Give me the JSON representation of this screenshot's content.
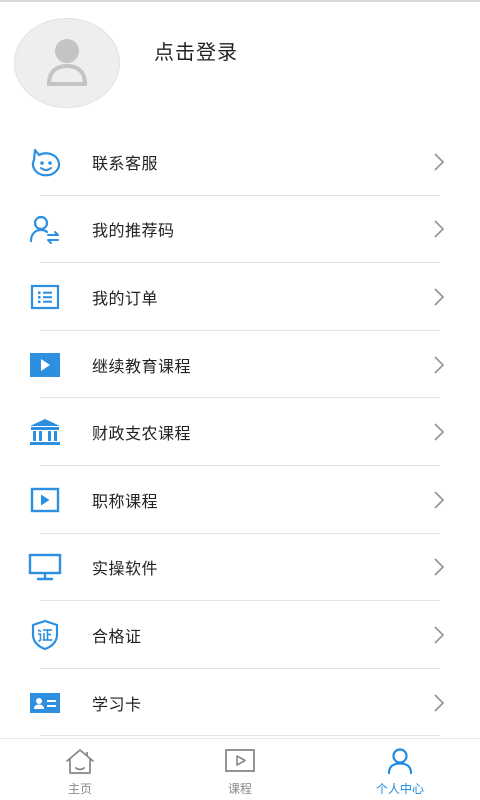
{
  "header": {
    "login_text": "点击登录"
  },
  "menu": {
    "items": [
      {
        "label": "联系客服",
        "icon": "service-face-icon"
      },
      {
        "label": "我的推荐码",
        "icon": "user-share-icon"
      },
      {
        "label": "我的订单",
        "icon": "order-list-icon"
      },
      {
        "label": "继续教育课程",
        "icon": "play-video-filled-icon"
      },
      {
        "label": "财政支农课程",
        "icon": "bank-building-icon"
      },
      {
        "label": "职称课程",
        "icon": "play-video-outline-icon"
      },
      {
        "label": "实操软件",
        "icon": "monitor-icon"
      },
      {
        "label": "合格证",
        "icon": "certificate-shield-icon"
      },
      {
        "label": "学习卡",
        "icon": "id-card-icon"
      }
    ]
  },
  "tabbar": {
    "tabs": [
      {
        "label": "主页",
        "icon": "home-icon"
      },
      {
        "label": "课程",
        "icon": "course-play-icon"
      },
      {
        "label": "个人中心",
        "icon": "person-icon"
      }
    ],
    "active_index": 2
  },
  "colors": {
    "accent": "#1c8be4",
    "icon_blue": "#2c8fe0",
    "divider": "#e4e4e4",
    "inactive": "#888888"
  }
}
